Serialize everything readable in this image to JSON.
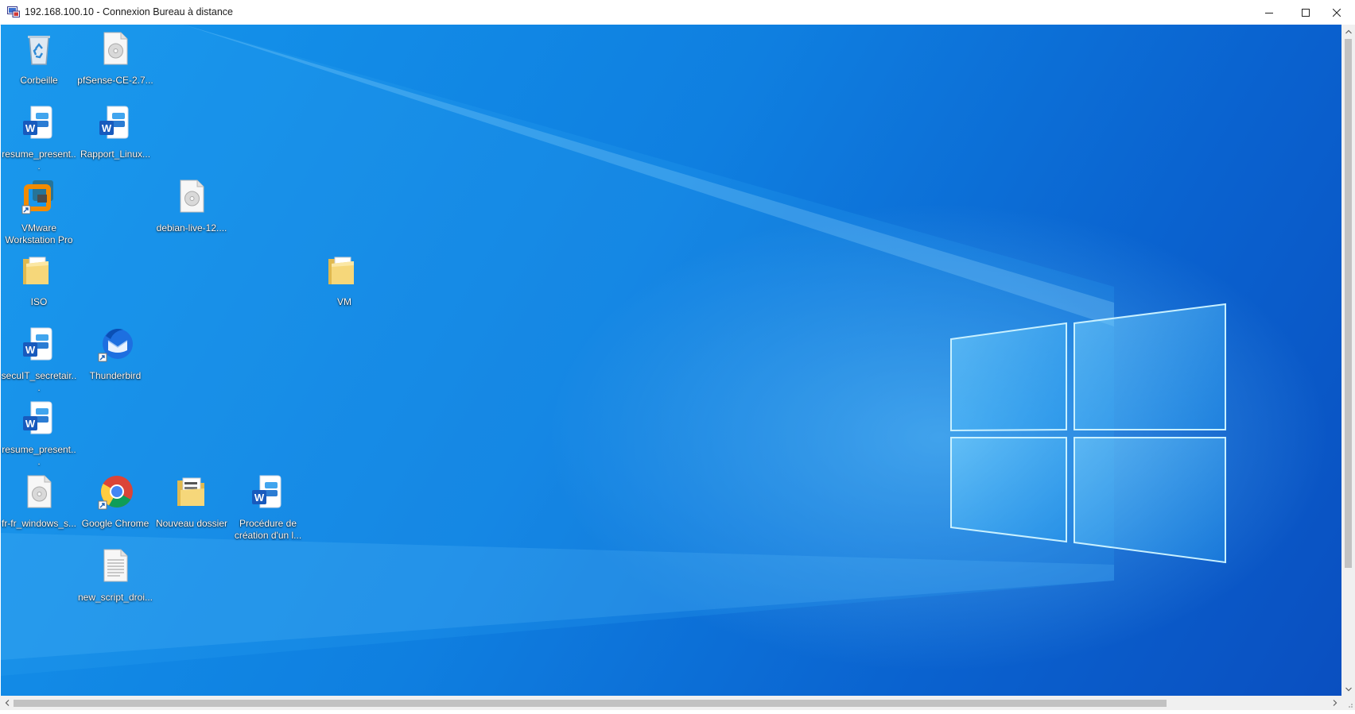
{
  "window": {
    "title": "192.168.100.10 - Connexion Bureau à distance",
    "controls": [
      "minimize",
      "maximize",
      "close"
    ]
  },
  "colors": {
    "desktop_blue": "#0f7fe0",
    "titlebar_bg": "#ffffff",
    "scrollbar_bg": "#f0f0f0"
  },
  "desktop": {
    "icons": [
      {
        "label": "Corbeille",
        "icon": "recycle-bin-icon"
      },
      {
        "label": "pfSense-CE-2.7...",
        "icon": "disc-image-icon"
      },
      {
        "label": "resume_present...",
        "icon": "word-document-icon"
      },
      {
        "label": "Rapport_Linux...",
        "icon": "word-document-icon"
      },
      {
        "label": "VMware Workstation Pro",
        "icon": "vmware-icon"
      },
      {
        "label": "debian-live-12....",
        "icon": "disc-image-icon"
      },
      {
        "label": "ISO",
        "icon": "folder-icon"
      },
      {
        "label": "VM",
        "icon": "folder-icon"
      },
      {
        "label": "secuIT_secretair...",
        "icon": "word-document-icon"
      },
      {
        "label": "Thunderbird",
        "icon": "thunderbird-icon"
      },
      {
        "label": "resume_present...",
        "icon": "word-document-icon"
      },
      {
        "label": "fr-fr_windows_s...",
        "icon": "disc-image-icon"
      },
      {
        "label": "Google Chrome",
        "icon": "chrome-icon"
      },
      {
        "label": "Nouveau dossier",
        "icon": "folder-icon"
      },
      {
        "label": "Procédure de création d'un l...",
        "icon": "word-document-icon"
      },
      {
        "label": "new_script_droi...",
        "icon": "text-file-icon"
      }
    ]
  }
}
